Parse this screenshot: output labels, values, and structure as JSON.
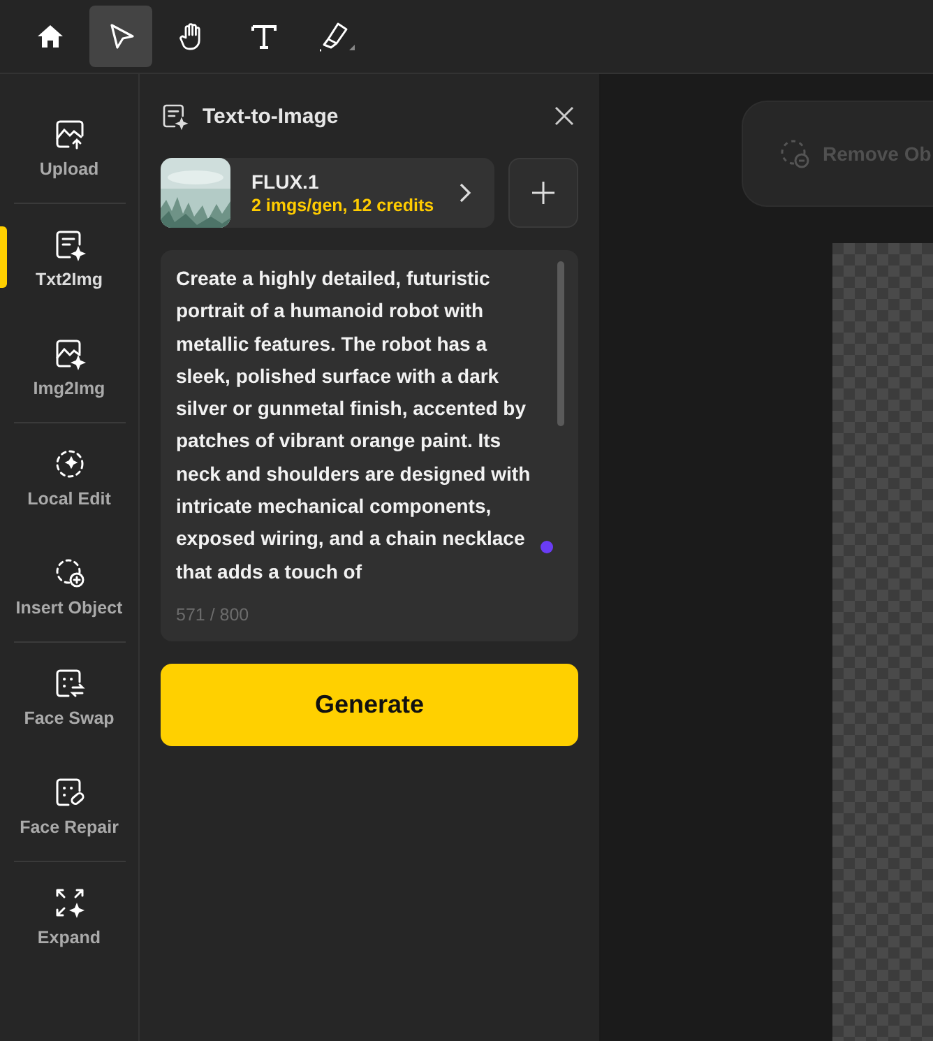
{
  "toolbar": [
    {
      "kind": "home",
      "selected": false
    },
    {
      "kind": "select",
      "selected": true
    },
    {
      "kind": "hand",
      "selected": false
    },
    {
      "kind": "text",
      "selected": false
    },
    {
      "kind": "brush",
      "selected": false
    }
  ],
  "sidebar": {
    "groups": [
      [
        {
          "label": "Upload",
          "kind": "upload",
          "selected": false
        }
      ],
      [
        {
          "label": "Txt2Img",
          "kind": "txt2img",
          "selected": true
        },
        {
          "label": "Img2Img",
          "kind": "img2img",
          "selected": false
        }
      ],
      [
        {
          "label": "Local Edit",
          "kind": "localedit",
          "selected": false
        },
        {
          "label": "Insert Object",
          "kind": "insert",
          "selected": false
        }
      ],
      [
        {
          "label": "Face Swap",
          "kind": "faceswap",
          "selected": false
        },
        {
          "label": "Face Repair",
          "kind": "facerepair",
          "selected": false
        }
      ],
      [
        {
          "label": "Expand",
          "kind": "expand",
          "selected": false
        }
      ]
    ]
  },
  "panel": {
    "title": "Text-to-Image",
    "model": {
      "name": "FLUX.1",
      "details": "2 imgs/gen, 12 credits"
    },
    "prompt": {
      "value": "Create a highly detailed, futuristic portrait of a humanoid robot with metallic features. The robot has a sleek, polished surface with a dark silver or gunmetal finish, accented by patches of vibrant orange paint. Its neck and shoulders are designed with intricate mechanical components, exposed wiring, and a chain necklace that adds a touch of",
      "counter": "571 / 800"
    },
    "generate_button": "Generate"
  },
  "canvas": {
    "remove_button": "Remove Ob"
  }
}
